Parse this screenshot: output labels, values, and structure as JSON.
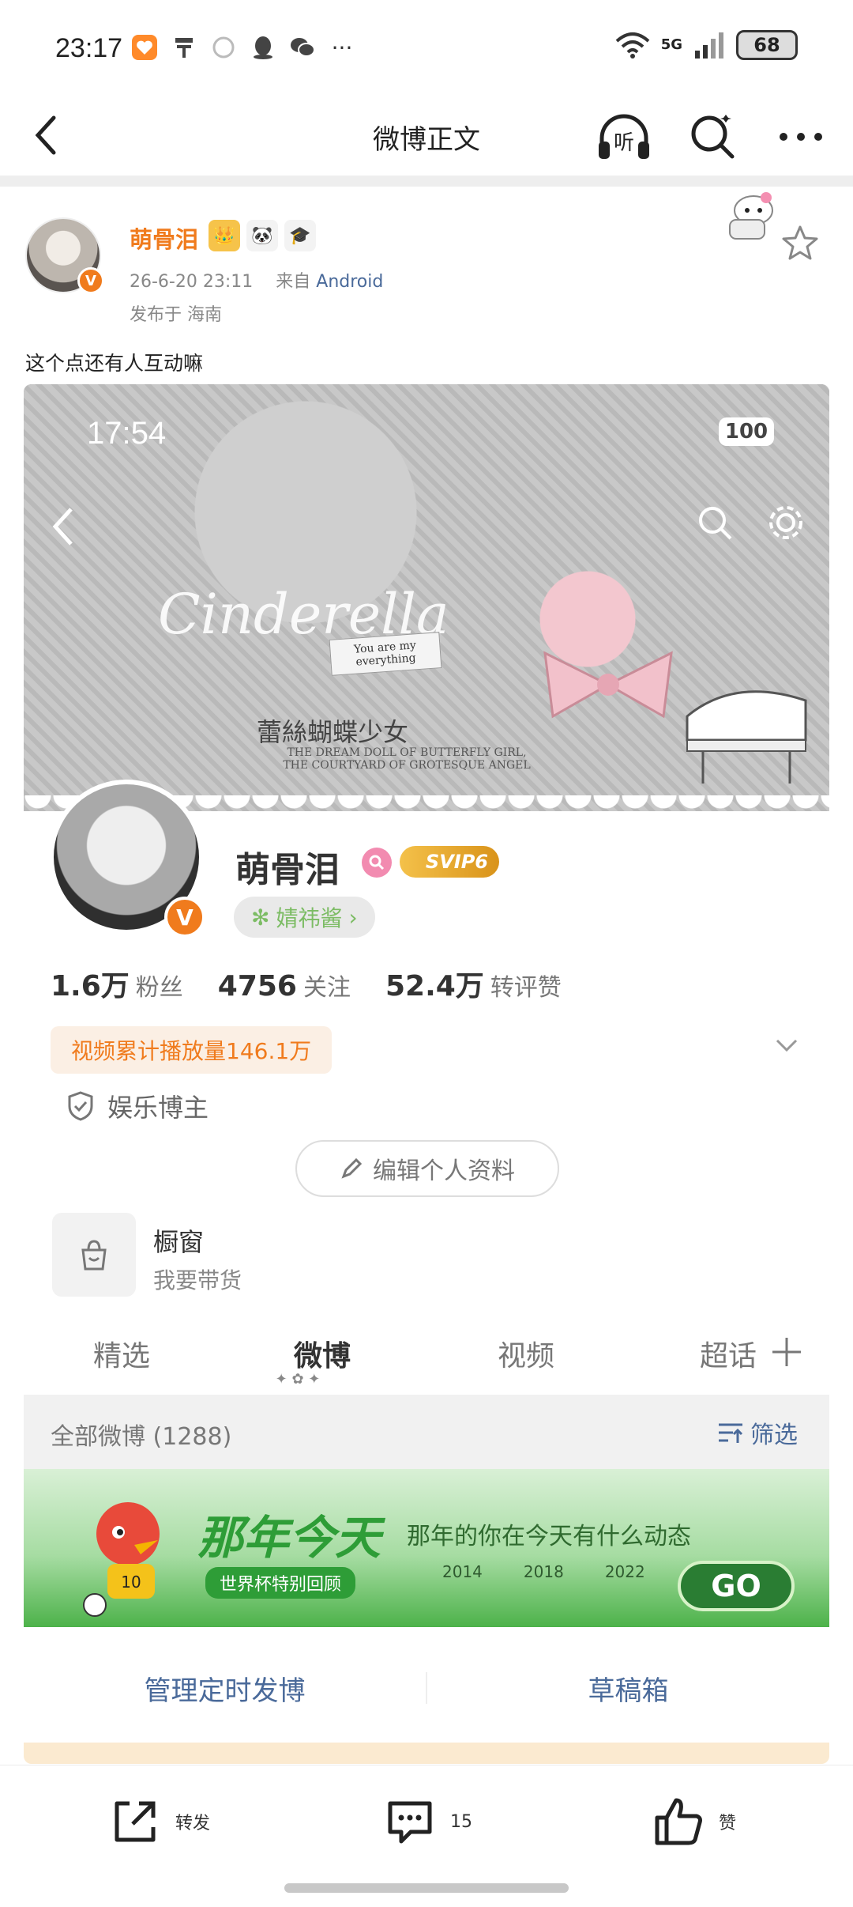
{
  "status_bar": {
    "time": "23:17",
    "network": "5G",
    "battery": "68",
    "more": "···"
  },
  "nav": {
    "title": "微博正文",
    "listen_label": "听"
  },
  "post": {
    "author": "萌骨泪",
    "date": "26-6-20 23:11",
    "from_prefix": "来自",
    "source": "Android",
    "location": "发布于 海南",
    "text": "这个点还有人互动嘛"
  },
  "screenshot": {
    "time": "17:54",
    "battery": "100",
    "banner_script": "Cinderella",
    "banner_note": "You are my everything",
    "banner_cn": "蕾絲蝴蝶少女",
    "banner_en": "THE DREAM DOLL OF BUTTERFLY GIRL, THE COURTYARD OF GROTESQUE ANGEL",
    "profile": {
      "name": "萌骨泪",
      "svip": "SVIP6",
      "tag": "婧祎酱",
      "stats": [
        {
          "num": "1.6万",
          "label": "粉丝"
        },
        {
          "num": "4756",
          "label": "关注"
        },
        {
          "num": "52.4万",
          "label": "转评赞"
        }
      ],
      "video_plays": "视频累计播放量146.1万",
      "cert": "娱乐博主",
      "edit": "编辑个人资料",
      "shop_title": "橱窗",
      "shop_sub": "我要带货"
    },
    "tabs": [
      {
        "label": "精选"
      },
      {
        "label": "微博"
      },
      {
        "label": "视频"
      },
      {
        "label": "超话"
      }
    ],
    "list_title": "全部微博 (1288)",
    "filter": "筛选",
    "ad": {
      "title": "那年今天",
      "subtitle": "那年的你在今天有什么动态",
      "pill": "世界杯特别回顾",
      "years": [
        "2014",
        "2018",
        "2022"
      ],
      "go": "GO"
    },
    "actions": [
      "管理定时发博",
      "草稿箱"
    ]
  },
  "bottom_bar": {
    "repost": "转发",
    "comments": "15",
    "like": "赞"
  },
  "colors": {
    "accent_orange": "#f07b1d",
    "link_blue": "#4a6a9a"
  }
}
